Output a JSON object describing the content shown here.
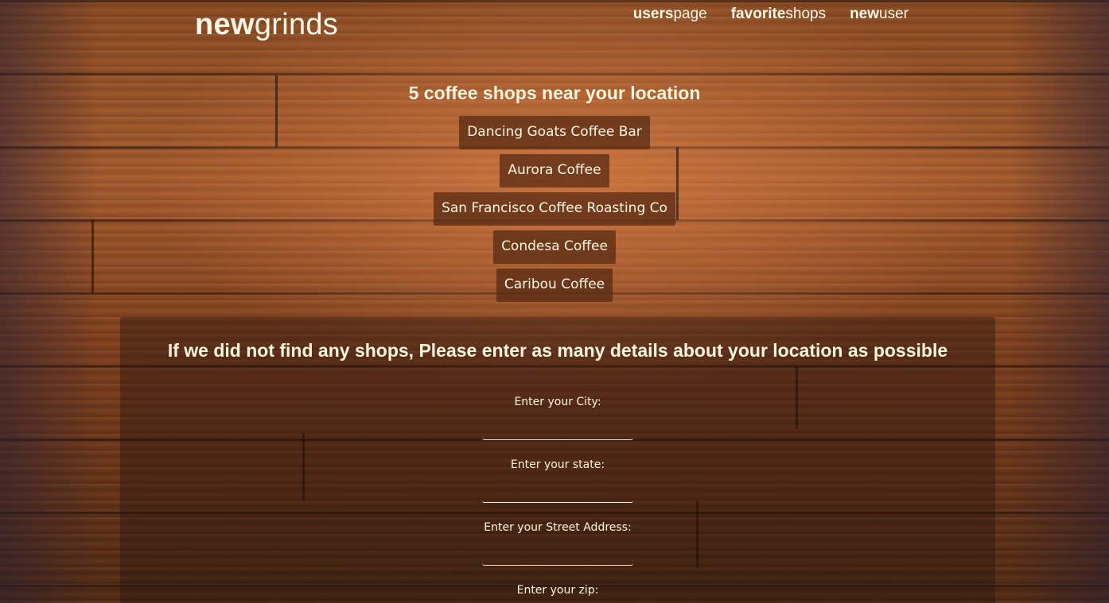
{
  "header": {
    "logo_bold": "new",
    "logo_light": "grinds",
    "nav": [
      {
        "bold": "users",
        "light": "page"
      },
      {
        "bold": "favorite",
        "light": "shops"
      },
      {
        "bold": "new",
        "light": "user"
      }
    ]
  },
  "results": {
    "heading": "5 coffee shops near your location",
    "shops": [
      "Dancing Goats Coffee Bar",
      "Aurora Coffee",
      "San Francisco Coffee Roasting Co",
      "Condesa Coffee",
      "Caribou Coffee"
    ]
  },
  "location_form": {
    "heading": "If we did not find any shops, Please enter as many details about your location as possible",
    "city_label": "Enter your City:",
    "city_value": "",
    "state_label": "Enter your state:",
    "state_value": "",
    "street_label": "Enter your Street Address:",
    "street_value": "",
    "zip_label": "Enter your zip:",
    "zip_value": ""
  }
}
